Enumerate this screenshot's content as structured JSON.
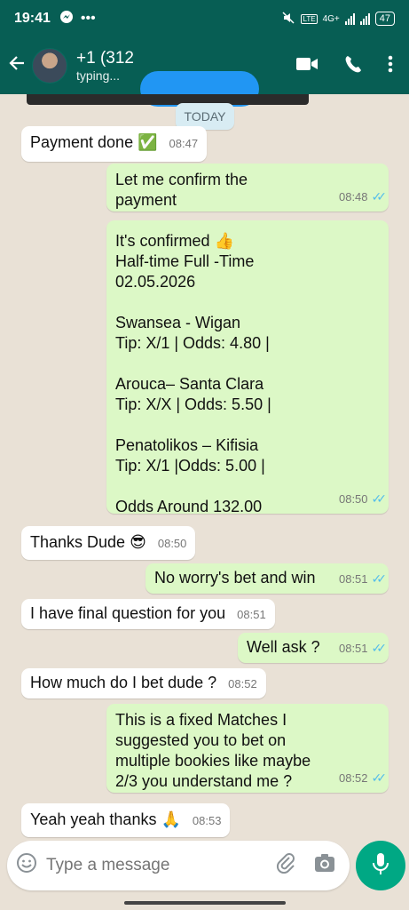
{
  "statusbar": {
    "time": "19:41",
    "network": "4G+",
    "battery": "47"
  },
  "header": {
    "contact_name": "+1 (312",
    "status": "typing..."
  },
  "date_chip": "TODAY",
  "messages": [
    {
      "dir": "in",
      "text": "Payment done",
      "emoji": "✅",
      "time": "08:47"
    },
    {
      "dir": "out",
      "text": "Let me confirm the payment",
      "time": "08:48"
    },
    {
      "dir": "out",
      "text": "It's confirmed 👍\nHalf-time Full -Time\n02.05.2026\n\nSwansea - Wigan\nTip: X/1 | Odds: 4.80 |\n\nArouca– Santa Clara\nTip: X/X | Odds: 5.50 |\n\nPenatolikos – Kifisia\nTip: X/1 |Odds: 5.00 |\n\nOdds Around 132.00",
      "time": "08:50"
    },
    {
      "dir": "in",
      "text": "Thanks Dude",
      "emoji": "😎",
      "time": "08:50"
    },
    {
      "dir": "out",
      "text": "No worry's bet and win",
      "time": "08:51"
    },
    {
      "dir": "in",
      "text": "I have final question for you",
      "time": "08:51"
    },
    {
      "dir": "out",
      "text": "Well ask ?",
      "time": "08:51"
    },
    {
      "dir": "in",
      "text": "How much do I bet dude ?",
      "time": "08:52"
    },
    {
      "dir": "out",
      "text": "This is a fixed Matches I suggested you to bet on multiple bookies like maybe 2/3 you understand me ?",
      "time": "08:52"
    },
    {
      "dir": "in",
      "text": "Yeah yeah thanks",
      "emoji": "🙏",
      "time": "08:53"
    }
  ],
  "input": {
    "placeholder": "Type a message"
  },
  "colors": {
    "header": "#075e54",
    "outgoing": "#dcf8c6",
    "incoming": "#ffffff",
    "accent": "#00a884",
    "read_ticks": "#53bdeb"
  }
}
